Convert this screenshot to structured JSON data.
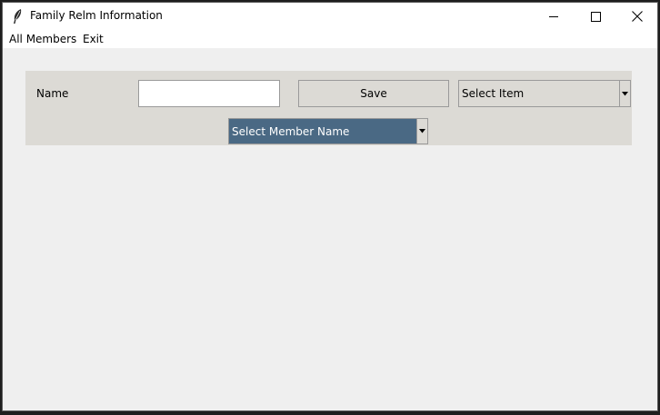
{
  "window": {
    "title": "Family Relm Information",
    "controls": [
      "minimize-icon",
      "maximize-icon",
      "close-icon"
    ]
  },
  "menubar": {
    "items": [
      "All Members",
      "Exit"
    ]
  },
  "form": {
    "name_label": "Name",
    "name_value": "",
    "save_label": "Save",
    "item_select": "Select Item",
    "member_select": "Select Member Name"
  },
  "colors": {
    "panel": "#dcdad5",
    "background": "#efefef",
    "selection": "#4a6984"
  }
}
